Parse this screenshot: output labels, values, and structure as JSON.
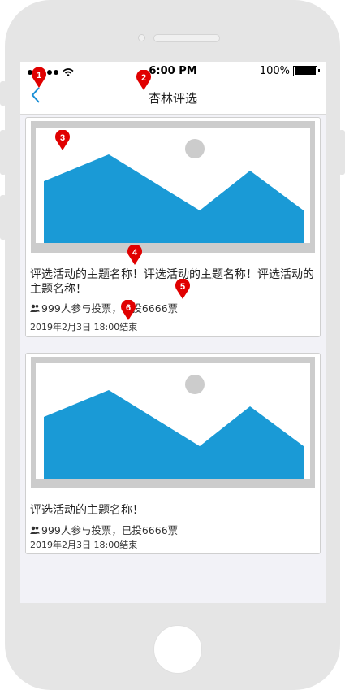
{
  "status_bar": {
    "time": "6:00 PM",
    "battery": "100%"
  },
  "nav": {
    "title": "杏林评选"
  },
  "cards": [
    {
      "title": "评选活动的主题名称！评选活动的主题名称！评选活动的主题名称！",
      "votes": "999人参与投票，已投6666票",
      "date": "2019年2月3日  18:00结束"
    },
    {
      "title": "评选活动的主题名称！",
      "votes": "999人参与投票，已投6666票",
      "date": "2019年2月3日  18:00结束"
    }
  ],
  "markers": [
    "1",
    "2",
    "3",
    "4",
    "5",
    "6"
  ],
  "colors": {
    "accent": "#1a8fd6",
    "image_fill": "#1a9ad6",
    "marker": "#e00000"
  }
}
